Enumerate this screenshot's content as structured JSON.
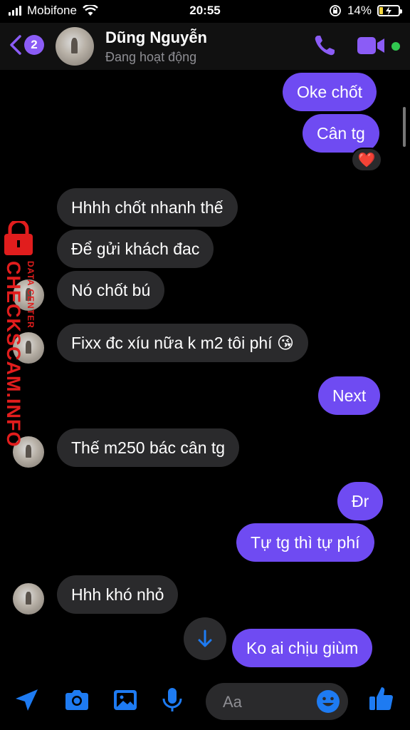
{
  "status_bar": {
    "carrier": "Mobifone",
    "time": "20:55",
    "battery": "14%"
  },
  "header": {
    "unread_count": "2",
    "name": "Dũng Nguyễn",
    "status": "Đang hoạt động"
  },
  "messages": [
    {
      "text": "Oke chốt",
      "dir": "out"
    },
    {
      "text": "Cân tg",
      "dir": "out",
      "reaction": "❤️"
    },
    {
      "text": "Hhhh chốt nhanh thế",
      "dir": "in"
    },
    {
      "text": "Để gửi khách đac",
      "dir": "in"
    },
    {
      "text": "Nó chốt bú",
      "dir": "in"
    },
    {
      "text": "Fixx đc xíu nữa k m2 tôi phí 😘",
      "dir": "in"
    },
    {
      "text": "Next",
      "dir": "out"
    },
    {
      "text": "Thế m250 bác cân tg",
      "dir": "in"
    },
    {
      "text": "Đr",
      "dir": "out"
    },
    {
      "text": "Tự tg thì tự phí",
      "dir": "out"
    },
    {
      "text": "Hhh khó nhỏ",
      "dir": "in"
    },
    {
      "text": "Ko ai chịu giùm",
      "dir": "out"
    }
  ],
  "watermark": {
    "main": "CHECKSCAM.INFO",
    "sub": "DATA CENTER"
  },
  "composer": {
    "placeholder": "Aa"
  },
  "colors": {
    "accent": "#8b5cf6",
    "outgoing_bubble": "#6f4bf2",
    "incoming_bubble": "#2a2a2c",
    "icon_blue": "#1e7bf2"
  }
}
